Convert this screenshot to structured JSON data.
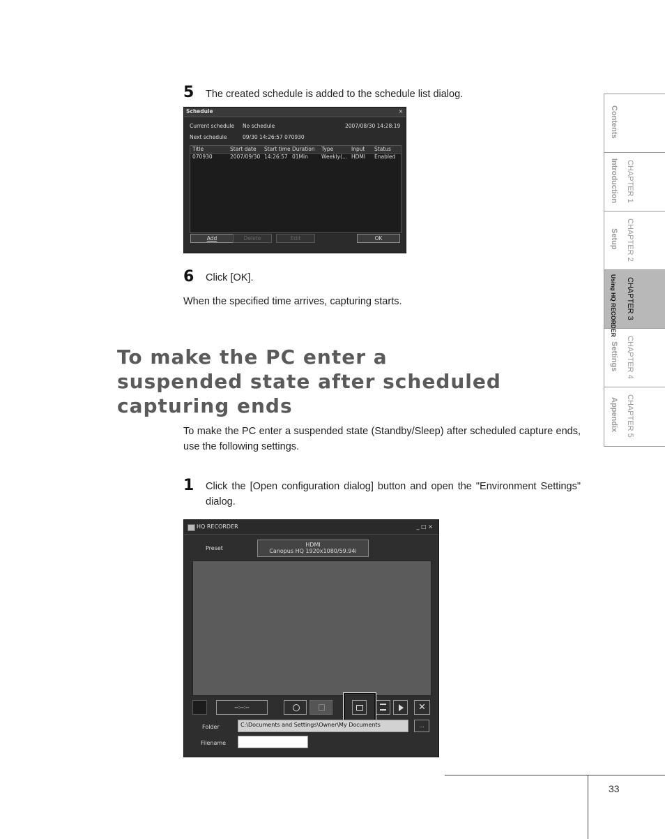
{
  "side_tabs": [
    {
      "title": "Contents",
      "chapter": ""
    },
    {
      "title": "Introduction",
      "chapter": "CHAPTER 1"
    },
    {
      "title": "Setup",
      "chapter": "CHAPTER 2"
    },
    {
      "title": "Using HQ RECORDER",
      "chapter": "CHAPTER 3"
    },
    {
      "title": "Settings",
      "chapter": "CHAPTER 4"
    },
    {
      "title": "Appendix",
      "chapter": "CHAPTER 5"
    }
  ],
  "step5": {
    "num": "5",
    "text": "The created schedule is added to the schedule list dialog."
  },
  "schedule_dialog": {
    "title": "Schedule",
    "close": "×",
    "current_label": "Current schedule",
    "current_value": "No schedule",
    "datetime": "2007/08/30 14:28:19",
    "next_label": "Next schedule",
    "next_value": "09/30 14:26:57 070930",
    "columns": [
      "Title",
      "Start date",
      "Start time",
      "Duration",
      "Type",
      "Input",
      "Status"
    ],
    "row": [
      "070930",
      "2007/09/30",
      "14:26:57",
      "01Min",
      "Weekly(...",
      "HDMI",
      "Enabled"
    ],
    "btn_add": "Add",
    "btn_delete": "Delete",
    "btn_edit": "Edit",
    "btn_ok": "OK"
  },
  "step6": {
    "num": "6",
    "text": "Click [OK]."
  },
  "step6_note": "When the specified time arrives, capturing starts.",
  "heading_lines": [
    "To make the PC enter a",
    "suspended state after scheduled",
    "capturing ends"
  ],
  "intro_text": "To make the PC enter a suspended state (Standby/Sleep) after scheduled capture ends, use the following settings.",
  "step1": {
    "num": "1",
    "text": "Click the [Open configuration dialog] button and open the \"Environment Settings\" dialog."
  },
  "hq_window": {
    "title": "HQ RECORDER",
    "controls": "_ □ ×",
    "preset_label": "Preset",
    "preset_line1": "HDMI",
    "preset_line2": "Canopus HQ 1920x1080/59.94i",
    "timecode": "--:--:--",
    "folder_label": "Folder",
    "folder_path": "C:\\Documents and Settings\\Owner\\My Documents",
    "browse": "...",
    "filename_label": "Filename",
    "filename_value": ""
  },
  "page_number": "33"
}
